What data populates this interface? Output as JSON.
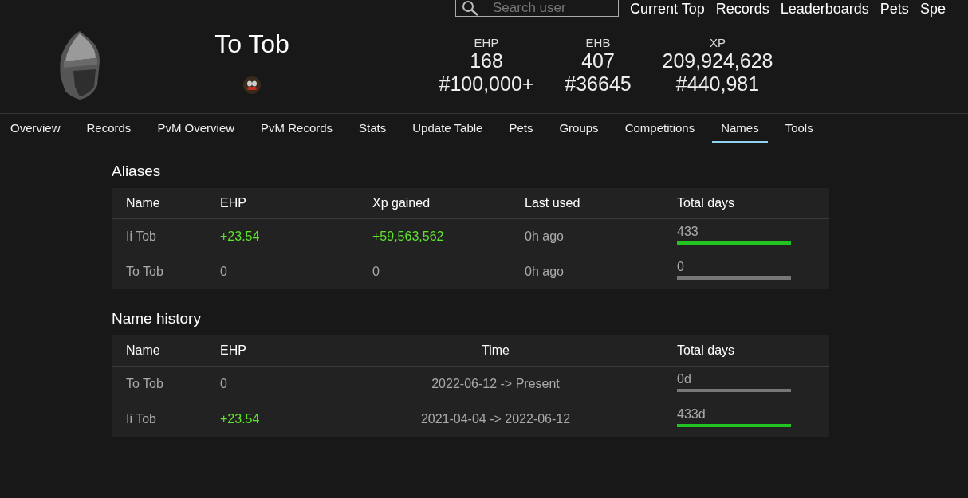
{
  "top_nav": {
    "search": {
      "placeholder": "Search user"
    },
    "links": [
      "Current Top",
      "Records",
      "Leaderboards",
      "Pets",
      "Spe"
    ]
  },
  "player": {
    "name": "To Tob",
    "stats": [
      {
        "label": "EHP",
        "value": "168",
        "rank": "#100,000+"
      },
      {
        "label": "EHB",
        "value": "407",
        "rank": "#36645"
      },
      {
        "label": "XP",
        "value": "209,924,628",
        "rank": "#440,981"
      }
    ]
  },
  "tabs": [
    {
      "label": "Overview",
      "selected": false
    },
    {
      "label": "Records",
      "selected": false
    },
    {
      "label": "PvM Overview",
      "selected": false
    },
    {
      "label": "PvM Records",
      "selected": false
    },
    {
      "label": "Stats",
      "selected": false
    },
    {
      "label": "Update Table",
      "selected": false
    },
    {
      "label": "Pets",
      "selected": false
    },
    {
      "label": "Groups",
      "selected": false
    },
    {
      "label": "Competitions",
      "selected": false
    },
    {
      "label": "Names",
      "selected": true
    },
    {
      "label": "Tools",
      "selected": false
    }
  ],
  "aliases": {
    "title": "Aliases",
    "columns": [
      "Name",
      "EHP",
      "Xp gained",
      "Last used",
      "Total days"
    ],
    "rows": [
      {
        "name": "Ii Tob",
        "ehp": "+23.54",
        "positive": true,
        "xp_gained": "+59,563,562",
        "last_used": "0h ago",
        "total_days": "433",
        "level": 1
      },
      {
        "name": "To Tob",
        "ehp": "0",
        "positive": false,
        "xp_gained": "0",
        "last_used": "0h ago",
        "total_days": "0",
        "level": 0
      }
    ]
  },
  "name_history": {
    "title": "Name history",
    "columns": [
      "Name",
      "EHP",
      "Time",
      "Total days"
    ],
    "rows": [
      {
        "name": "To Tob",
        "ehp": "0",
        "positive": false,
        "time": "2022-06-12 -> Present",
        "total_days": "0d",
        "level": 0
      },
      {
        "name": "Ii Tob",
        "ehp": "+23.54",
        "positive": true,
        "time": "2021-04-04 -> 2022-06-12",
        "total_days": "433d",
        "level": 1
      }
    ]
  }
}
